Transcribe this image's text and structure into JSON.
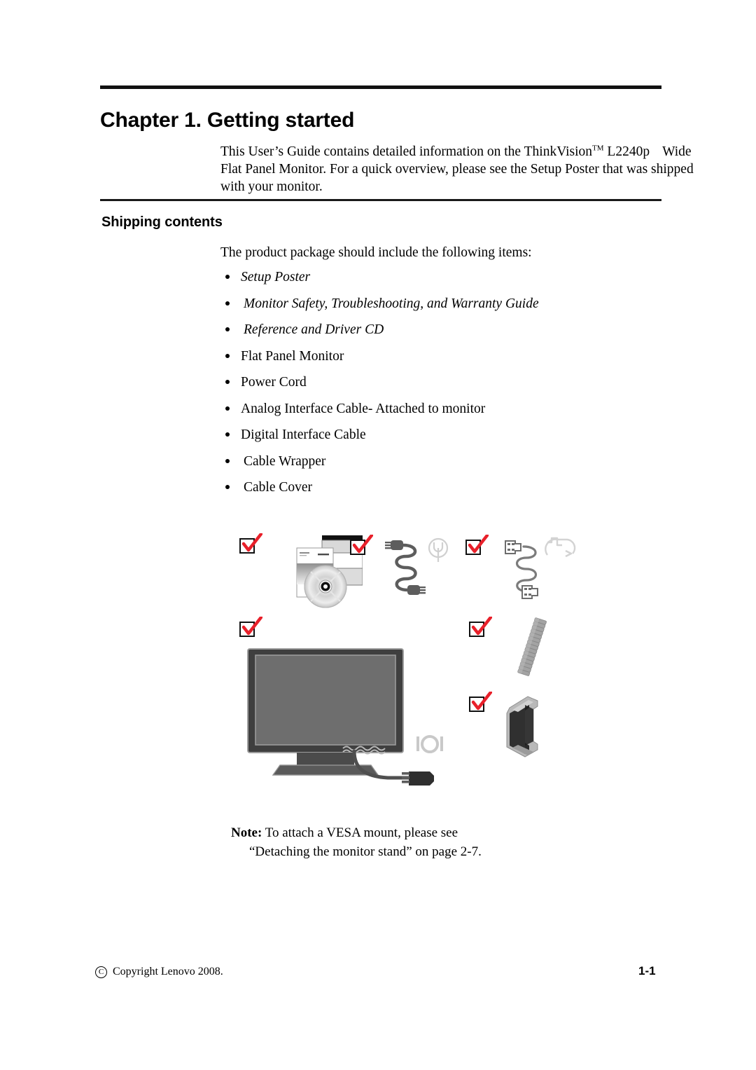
{
  "document": {
    "chapter_title": "Chapter 1. Getting started",
    "intro_paragraph_part1": "This User’s Guide contains detailed information on the ThinkVision",
    "intro_trademark": "TM",
    "intro_paragraph_part2": "L2240p",
    "intro_paragraph_part3": "Wide Flat Panel Monitor. For a quick overview, please see the Setup Poster that was shipped with your monitor.",
    "section_title": "Shipping contents",
    "lead_text": "The product package should include the following items:",
    "items": [
      {
        "label": "Setup Poster",
        "style": "italic"
      },
      {
        "label": "Monitor Safety, Troubleshooting, and Warranty Guide",
        "style": "italic"
      },
      {
        "label": "Reference and Driver CD",
        "style": "italic"
      },
      {
        "label": "Flat Panel Monitor",
        "style": "normal"
      },
      {
        "label": "Power Cord",
        "style": "normal"
      },
      {
        "label": "Analog Interface Cable- Attached to monitor",
        "style": "normal"
      },
      {
        "label": "Digital Interface Cable",
        "style": "normal"
      },
      {
        "label": "Cable Wrapper",
        "style": "normal"
      },
      {
        "label": "Cable Cover",
        "style": "normal"
      }
    ],
    "note": {
      "label": "Note:",
      "line1": " To attach a VESA mount, please see",
      "line2": "“Detaching the monitor stand” on page 2-7."
    },
    "footer": {
      "copyright_symbol": "C",
      "copyright_text": "Copyright Lenovo 2008.",
      "page_number": "1-1"
    }
  },
  "figure": {
    "caption_items": [
      {
        "name": "documents-and-cd",
        "checked": true
      },
      {
        "name": "power-cord",
        "checked": true
      },
      {
        "name": "digital-interface-cable",
        "checked": true
      },
      {
        "name": "flat-panel-monitor",
        "checked": true
      },
      {
        "name": "cable-wrapper",
        "checked": true
      },
      {
        "name": "cable-cover",
        "checked": true
      }
    ],
    "check_color": "#e8202a",
    "box_color": "#111111",
    "monitor_bezel_color": "#3f3f3f",
    "monitor_screen_color": "#6e6e6e",
    "cable_color": "#595959",
    "port_icon_color": "#c9c9c9"
  }
}
